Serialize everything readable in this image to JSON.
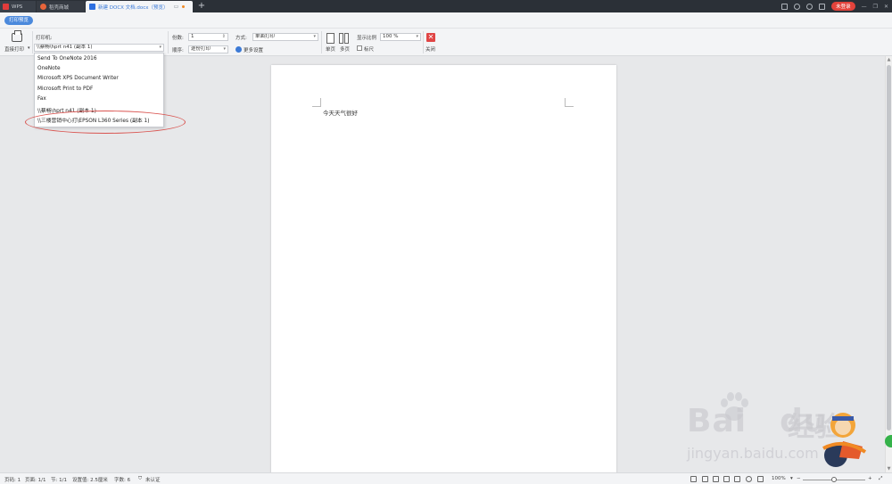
{
  "titlebar": {
    "tabs": [
      {
        "label": "WPS"
      },
      {
        "label": "稻壳商城"
      },
      {
        "label": "新建 DOCX 文档.docx（预览）"
      }
    ],
    "login_label": "未登录"
  },
  "ribbon": {
    "mode_tab": "打印预览",
    "direct_print": "直接打印",
    "printer_label": "打印机:",
    "printer_value": "\\\\蔡畅\\hprt n41 (副本 1)",
    "copies_label": "份数:",
    "copies_value": "1",
    "order_label": "顺序:",
    "order_value": "逐份打印",
    "mode_label": "方式:",
    "mode_value": "单面打印",
    "more_settings": "更多设置",
    "single_page": "单页",
    "multi_page": "多页",
    "zoom_label": "显示比例",
    "zoom_value": "100 %",
    "ruler_label": "标尺",
    "close_label": "关闭"
  },
  "printer_dropdown": {
    "options": [
      "Send To OneNote 2016",
      "OneNote",
      "Microsoft XPS Document Writer",
      "Microsoft Print to PDF",
      "Fax",
      "\\\\蔡畅\\hprt n41 (副本 1)",
      "\\\\三楼营销中心打\\EPSON L360 Series (副本 1)"
    ]
  },
  "document": {
    "text": "今天天气很好"
  },
  "statusbar": {
    "page": "页码: 1",
    "pages": "页面: 1/1",
    "section": "节: 1/1",
    "setting": "设置值: 2.5厘米",
    "words": "字数: 6",
    "auth": "未认证",
    "zoom": "100%"
  },
  "watermark": {
    "brand": "Bai",
    "brand2": "du",
    "cn": "经验",
    "url": "jingyan.baidu.com"
  },
  "colors": {
    "accent": "#4b89dc",
    "close": "#e04545",
    "login": "#e3433b",
    "titlebar": "#2b3037"
  }
}
